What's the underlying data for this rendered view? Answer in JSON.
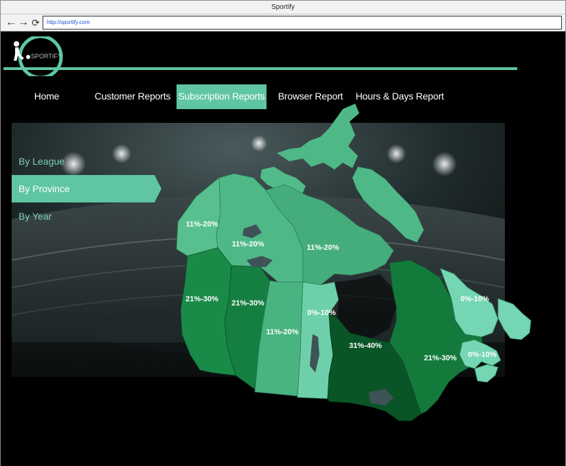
{
  "window": {
    "title": "Sportify"
  },
  "browser": {
    "url": "http://sportify.com"
  },
  "logo": {
    "text": "SPORTIFY"
  },
  "nav": [
    {
      "label": "Home",
      "active": false
    },
    {
      "label": "Customer Reports",
      "active": false
    },
    {
      "label": "Subscription Reports",
      "active": true
    },
    {
      "label": "Browser Report",
      "active": false
    },
    {
      "label": "Hours & Days Report",
      "active": false
    }
  ],
  "sidebar": [
    {
      "label": "By League",
      "active": false
    },
    {
      "label": "By Province",
      "active": true
    },
    {
      "label": "By Year",
      "active": false
    }
  ],
  "map": {
    "regions": [
      {
        "name": "Yukon",
        "label": "11%-20%",
        "color": "#58c08e"
      },
      {
        "name": "Northwest Territories",
        "label": "11%-20%",
        "color": "#4fb887"
      },
      {
        "name": "Nunavut",
        "label": "11%-20%",
        "color": "#45ad7c"
      },
      {
        "name": "British Columbia",
        "label": "21%-30%",
        "color": "#1a8a49"
      },
      {
        "name": "Alberta",
        "label": "21%-30%",
        "color": "#157f41"
      },
      {
        "name": "Saskatchewan",
        "label": "11%-20%",
        "color": "#49b47f"
      },
      {
        "name": "Manitoba",
        "label": "0%-10%",
        "color": "#6dd0aa"
      },
      {
        "name": "Ontario",
        "label": "31%-40%",
        "color": "#0a5527"
      },
      {
        "name": "Quebec",
        "label": "21%-30%",
        "color": "#137a3c"
      },
      {
        "name": "Newfoundland and Labrador",
        "label": "0%-10%",
        "color": "#74d6b2"
      },
      {
        "name": "Maritimes",
        "label": "0%-10%",
        "color": "#74d6b2"
      }
    ]
  }
}
